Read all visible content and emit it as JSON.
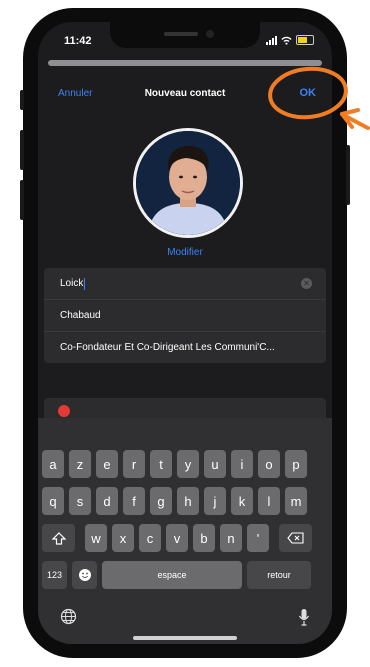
{
  "status": {
    "time": "11:42"
  },
  "nav": {
    "cancel": "Annuler",
    "title": "Nouveau contact",
    "ok": "OK"
  },
  "photo": {
    "modify_label": "Modifier"
  },
  "form": {
    "first_name": "Loick",
    "last_name": "Chabaud",
    "company": "Co-Fondateur Et Co-Dirigeant Les Communi'C..."
  },
  "keyboard": {
    "row1": [
      "a",
      "z",
      "e",
      "r",
      "t",
      "y",
      "u",
      "i",
      "o",
      "p"
    ],
    "row2": [
      "q",
      "s",
      "d",
      "f",
      "g",
      "h",
      "j",
      "k",
      "l",
      "m"
    ],
    "row3": [
      "w",
      "x",
      "c",
      "v",
      "b",
      "n",
      "'"
    ],
    "numbers_label": "123",
    "space_label": "espace",
    "return_label": "retour"
  },
  "colors": {
    "accent": "#3a82f7",
    "annotation": "#f07d24",
    "background": "#1c1c1e"
  }
}
